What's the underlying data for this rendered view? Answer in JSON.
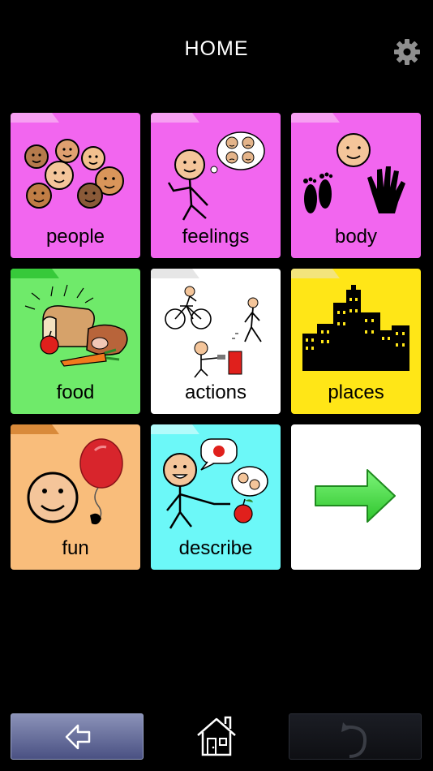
{
  "header": {
    "title": "HOME",
    "settings_icon": "gear-icon"
  },
  "tiles": [
    {
      "label": "people",
      "color": "#f266ef",
      "tab": "#f7a0f2",
      "icon": "faces-icon"
    },
    {
      "label": "feelings",
      "color": "#f266ef",
      "tab": "#f7a0f2",
      "icon": "thinking-person-icon"
    },
    {
      "label": "body",
      "color": "#f266ef",
      "tab": "#f7a0f2",
      "icon": "feet-hand-icon"
    },
    {
      "label": "food",
      "color": "#6fea6a",
      "tab": "#37c93a",
      "icon": "food-icon"
    },
    {
      "label": "actions",
      "color": "#ffffff",
      "tab": "#e6e6e6",
      "icon": "actions-icon"
    },
    {
      "label": "places",
      "color": "#ffe617",
      "tab": "#f3e47c",
      "icon": "city-icon"
    },
    {
      "label": "fun",
      "color": "#f9bd7b",
      "tab": "#d98a3a",
      "icon": "balloon-icon"
    },
    {
      "label": "describe",
      "color": "#6cf8f8",
      "tab": "#b3fbfb",
      "icon": "describe-icon"
    },
    {
      "label": "",
      "color": "#ffffff",
      "tab": "#ffffff",
      "icon": "next-arrow-icon"
    }
  ],
  "bottom_bar": {
    "back_icon": "back-arrow-icon",
    "home_icon": "home-icon",
    "redo_icon": "redo-icon"
  }
}
